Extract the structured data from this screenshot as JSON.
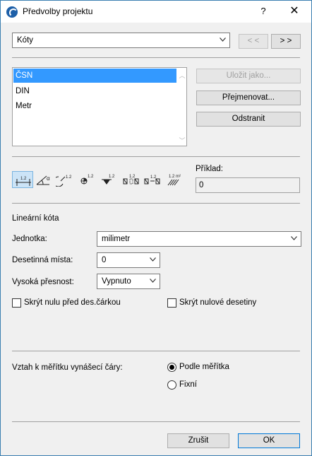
{
  "window": {
    "title": "Předvolby projektu",
    "help_glyph": "?",
    "close_glyph": "✕"
  },
  "category": {
    "selected": "Kóty",
    "prev_label": "< <",
    "next_label": "> >"
  },
  "schemes": {
    "items": [
      {
        "label": "ČSN",
        "selected": true
      },
      {
        "label": "DIN",
        "selected": false
      },
      {
        "label": "Metr",
        "selected": false
      }
    ],
    "save_as_label": "Uložit jako...",
    "rename_label": "Přejmenovat...",
    "delete_label": "Odstranit"
  },
  "dimension_types": {
    "icons": [
      {
        "name": "linear-dimension-icon",
        "text": "1.2",
        "active": true
      },
      {
        "name": "angle-dimension-icon",
        "text": "α",
        "active": false
      },
      {
        "name": "radial-dimension-icon",
        "text": "1.2",
        "active": false
      },
      {
        "name": "level-dimension-icon",
        "text": "1.2",
        "active": false
      },
      {
        "name": "elevation-dimension-icon",
        "text": "1.2",
        "active": false
      },
      {
        "name": "door-window-dimension-icon",
        "text": "",
        "active": false
      },
      {
        "name": "sill-height-dimension-icon",
        "text": "",
        "active": false
      },
      {
        "name": "area-dimension-icon",
        "text": "1.2 m²",
        "active": false
      }
    ],
    "example_label": "Příklad:",
    "example_value": "0"
  },
  "linear": {
    "section_title": "Lineární kóta",
    "unit_label": "Jednotka:",
    "unit_value": "milimetr",
    "decimals_label": "Desetinná místa:",
    "decimals_value": "0",
    "precision_label": "Vysoká přesnost:",
    "precision_value": "Vypnuto",
    "hide_zero_before_label": "Skrýt nulu před des.čárkou",
    "hide_zero_before_checked": false,
    "hide_zero_decimals_label": "Skrýt nulové desetiny",
    "hide_zero_decimals_checked": false
  },
  "scale": {
    "label": "Vztah k měřítku vynášecí čáry:",
    "options": [
      {
        "label": "Podle měřítka",
        "checked": true
      },
      {
        "label": "Fixní",
        "checked": false
      }
    ]
  },
  "footer": {
    "cancel_label": "Zrušit",
    "ok_label": "OK"
  }
}
